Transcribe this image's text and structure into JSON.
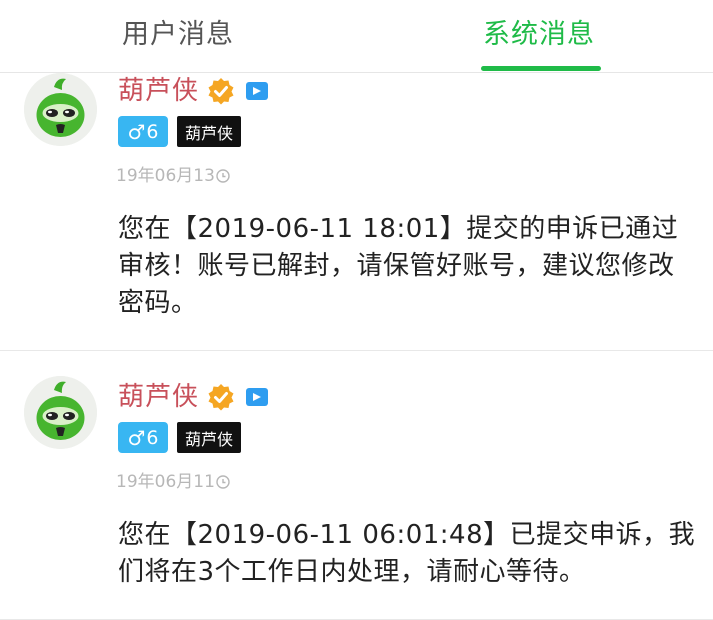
{
  "tabs": [
    {
      "label": "用户消息",
      "active": false
    },
    {
      "label": "系统消息",
      "active": true
    }
  ],
  "colors": {
    "accent": "#1fbb48",
    "name": "#c8505a",
    "gender_badge": "#38b6f2",
    "verified": "#f5a623",
    "video": "#2e9df0"
  },
  "messages": [
    {
      "sender": "葫芦侠",
      "level": "6",
      "gender_symbol": "♂",
      "tag": "葫芦侠",
      "date": "19年06月13",
      "content": "您在【2019-06-11 18:01】提交的申诉已通过审核！账号已解封，请保管好账号，建议您修改密码。",
      "icons": [
        "verified-icon",
        "video-icon",
        "clock-icon"
      ]
    },
    {
      "sender": "葫芦侠",
      "level": "6",
      "gender_symbol": "♂",
      "tag": "葫芦侠",
      "date": "19年06月11",
      "content": "您在【2019-06-11 06:01:48】已提交申诉，我们将在3个工作日内处理，请耐心等待。",
      "icons": [
        "verified-icon",
        "video-icon",
        "clock-icon"
      ]
    }
  ]
}
